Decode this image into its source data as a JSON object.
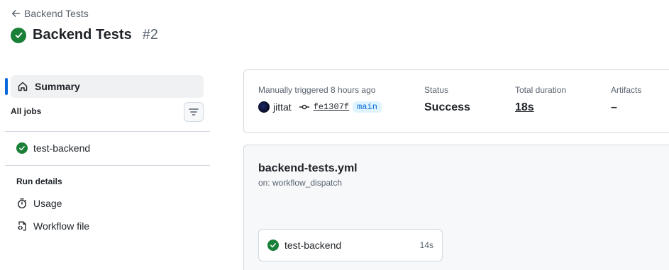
{
  "header": {
    "back_label": "Backend Tests",
    "title": "Backend Tests",
    "run_number": "#2"
  },
  "sidebar": {
    "summary_label": "Summary",
    "all_jobs_label": "All jobs",
    "jobs": [
      {
        "label": "test-backend"
      }
    ],
    "run_details_label": "Run details",
    "usage_label": "Usage",
    "workflow_file_label": "Workflow file"
  },
  "summary": {
    "trigger_label": "Manually triggered 8 hours ago",
    "user": "jittat",
    "commit": "fe1307f",
    "branch": "main",
    "status_label": "Status",
    "status_value": "Success",
    "duration_label": "Total duration",
    "duration_value": "18s",
    "artifacts_label": "Artifacts",
    "artifacts_value": "–"
  },
  "graph": {
    "workflow_file": "backend-tests.yml",
    "trigger": "on: workflow_dispatch",
    "jobs": [
      {
        "name": "test-backend",
        "duration": "14s"
      }
    ]
  },
  "colors": {
    "success": "#1a7f37",
    "accent": "#0969da",
    "muted": "#59636e",
    "border": "#d1d9e0"
  }
}
